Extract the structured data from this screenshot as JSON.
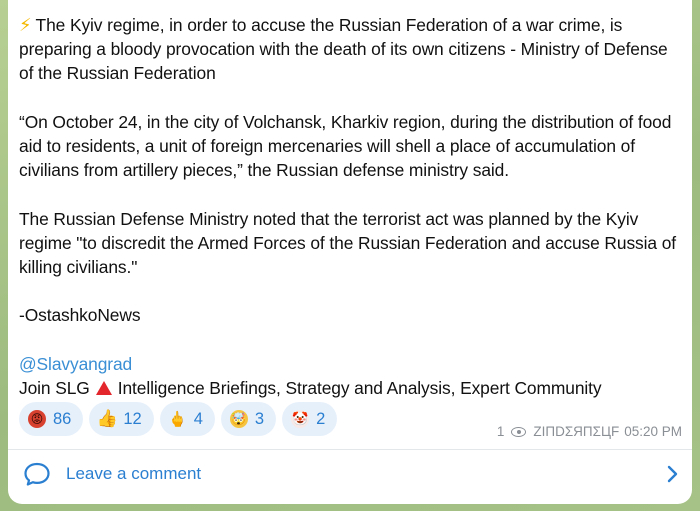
{
  "post": {
    "bolt_icon": "lightning-icon",
    "headline": "The Kyiv regime, in order to accuse the Russian Federation of a war crime, is preparing a bloody provocation with the death of its own citizens - Ministry of Defense of the Russian Federation",
    "quote": "“On October 24, in the city of Volchansk, Kharkiv region, during the distribution of food aid to residents, a unit of foreign mercenaries will shell a place of accumulation of civilians from artillery pieces,” the Russian defense ministry said.",
    "statement": "The Russian Defense Ministry noted that the terrorist act was planned by the Kyiv regime \"to discredit the Armed Forces of the Russian Federation and accuse Russia of killing civilians.\"",
    "source": "-OstashkoNews",
    "channel_link": "@Slavyangrad",
    "join_prefix": "Join SLG",
    "join_suffix": "Intelligence Briefings, Strategy and Analysis, Expert Community",
    "accent_red": "#e3262b"
  },
  "reactions": [
    {
      "icon": "angry-face-icon",
      "glyph": "😡",
      "count": "86"
    },
    {
      "icon": "thumbs-up-icon",
      "glyph": "👍",
      "count": "12"
    },
    {
      "icon": "finger-icon",
      "glyph": "🖕",
      "count": "4"
    },
    {
      "icon": "exploding-head-icon",
      "glyph": "🤯",
      "count": "3"
    },
    {
      "icon": "clown-face-icon",
      "glyph": "🤡",
      "count": "2"
    }
  ],
  "meta": {
    "views": "1",
    "author": "ZIПDΣЯПΣЦF",
    "time": "05:20 PM"
  },
  "footer": {
    "comment_label": "Leave a comment"
  },
  "colors": {
    "link": "#3a8fd5",
    "reaction_bg": "#e6f0fb",
    "meta_gray": "#8a8f95"
  }
}
